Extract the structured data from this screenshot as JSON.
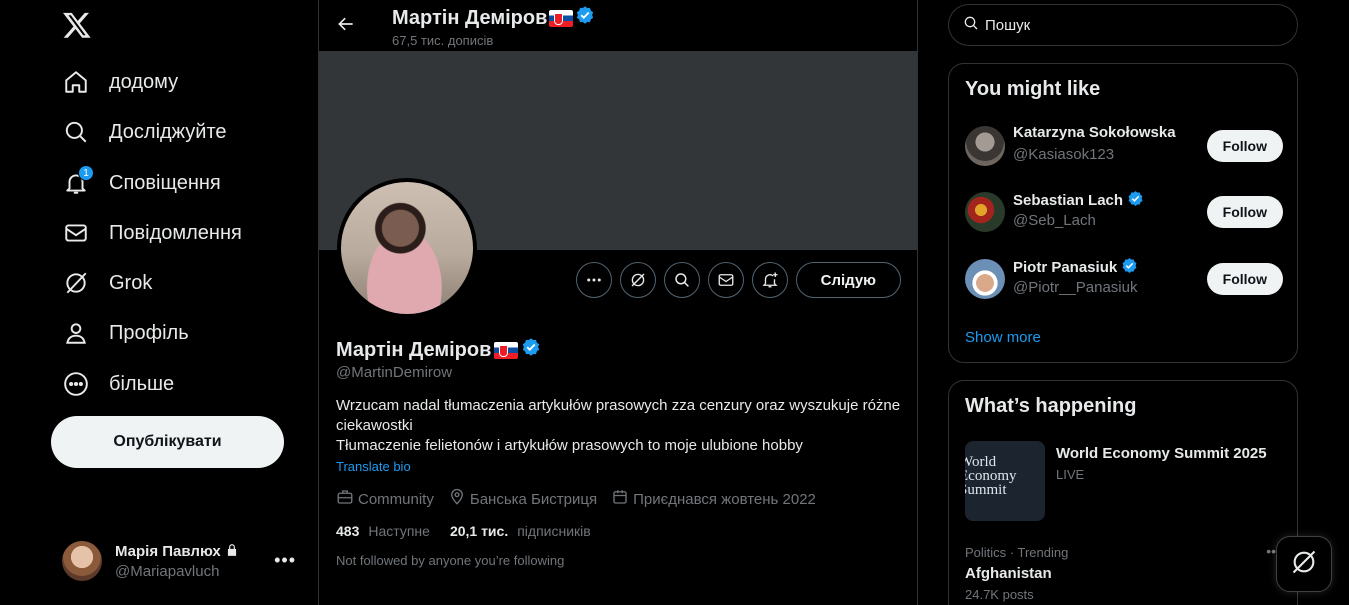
{
  "nav": {
    "items": [
      {
        "label": "додому",
        "icon": "home-icon"
      },
      {
        "label": "Досліджуйте",
        "icon": "search-icon"
      },
      {
        "label": "Сповіщення",
        "icon": "bell-icon",
        "badge": "1"
      },
      {
        "label": "Повідомлення",
        "icon": "mail-icon"
      },
      {
        "label": "Grok",
        "icon": "grok-icon"
      },
      {
        "label": "Профіль",
        "icon": "person-icon"
      },
      {
        "label": "більше",
        "icon": "more-circle-icon"
      }
    ],
    "post_label": "Опублікувати"
  },
  "account": {
    "name": "Марія Павлюх",
    "handle": "@Mariapavluch"
  },
  "header": {
    "name": "Мартін Деміров",
    "post_count": "67,5 тис. дописів"
  },
  "profile": {
    "name": "Мартін Деміров",
    "handle": "@MartinDemirow",
    "follow_label": "Слідую",
    "bio_line1": "Wrzucam nadal tłumaczenia artykułów prasowych zza cenzury oraz wyszukuje różne ciekawostki",
    "bio_line2": "Tłumaczenie felietonów i artykułów prasowych to moje ulubione hobby",
    "translate": "Translate bio",
    "category": "Community",
    "location": "Банська Бистриця",
    "joined": "Приєднався жовтень 2022",
    "following_count": "483",
    "following_label": "Наступне",
    "followers_count": "20,1 тис.",
    "followers_label": "підписників",
    "not_followed": "Not followed by anyone you’re following"
  },
  "search": {
    "placeholder": "Пошук"
  },
  "suggestions": {
    "title": "You might like",
    "items": [
      {
        "name": "Katarzyna Sokołowska",
        "handle": "@Kasiasok123",
        "verified": false
      },
      {
        "name": "Sebastian Lach",
        "handle": "@Seb_Lach",
        "verified": true
      },
      {
        "name": "Piotr Panasiuk",
        "handle": "@Piotr__Panasiuk",
        "verified": true
      }
    ],
    "follow_label": "Follow",
    "show_more": "Show more"
  },
  "happening": {
    "title": "What’s happening",
    "event_title": "World Economy Summit 2025",
    "event_status": "LIVE",
    "event_image_text": "World Economy Summit",
    "trend_category": "Politics · Trending",
    "trend_name": "Afghanistan",
    "trend_posts": "24.7K posts"
  },
  "colors": {
    "accent": "#1d9bf0",
    "background": "#000000",
    "border": "#2f3336",
    "muted": "#71767b"
  }
}
